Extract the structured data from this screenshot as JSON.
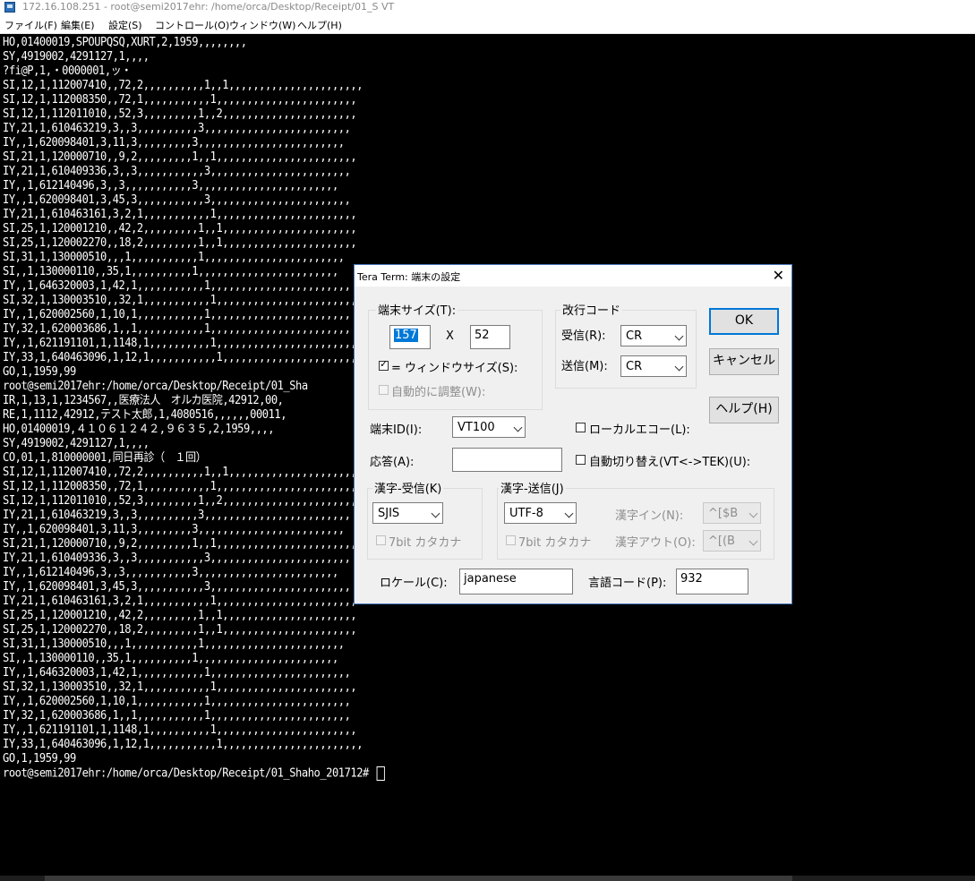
{
  "window": {
    "title": "172.16.108.251 - root@semi2017ehr: /home/orca/Desktop/Receipt/01_S VT"
  },
  "menubar": {
    "file": "ファイル(F)",
    "edit": "編集(E)",
    "setup": "設定(S)",
    "control": "コントロール(O)",
    "window": "ウィンドウ(W)",
    "help": "ヘルプ(H)"
  },
  "terminal": {
    "lines": [
      "HO,01400019,SPOUPQSQ,XURT,2,1959,,,,,,,,",
      "SY,4919002,4291127,1,,,,",
      "?fi@P,1,・0000001,ッ・",
      "SI,12,1,112007410,,72,2,,,,,,,,,,1,,1,,,,,,,,,,,,,,,,,,,,,,",
      "SI,12,1,112008350,,72,1,,,,,,,,,,,1,,,,,,,,,,,,,,,,,,,,,,,",
      "SI,12,1,112011010,,52,3,,,,,,,,,1,,2,,,,,,,,,,,,,,,,,,,,,,",
      "IY,21,1,610463219,3,,3,,,,,,,,,,3,,,,,,,,,,,,,,,,,,,,,,,,",
      "IY,,1,620098401,3,11,3,,,,,,,,,3,,,,,,,,,,,,,,,,,,,,,,,,",
      "SI,21,1,120000710,,9,2,,,,,,,,,1,,1,,,,,,,,,,,,,,,,,,,,,,,",
      "IY,21,1,610409336,3,,3,,,,,,,,,,,3,,,,,,,,,,,,,,,,,,,,,,,",
      "IY,,1,612140496,3,,3,,,,,,,,,,,3,,,,,,,,,,,,,,,,,,,,,,,",
      "IY,,1,620098401,3,45,3,,,,,,,,,,,3,,,,,,,,,,,,,,,,,,,,,,,",
      "IY,21,1,610463161,3,2,1,,,,,,,,,,,1,,,,,,,,,,,,,,,,,,,,,,,",
      "SI,25,1,120001210,,42,2,,,,,,,,,1,,1,,,,,,,,,,,,,,,,,,,,,,",
      "SI,25,1,120002270,,18,2,,,,,,,,,1,,1,,,,,,,,,,,,,,,,,,,,,,",
      "SI,31,1,130000510,,,1,,,,,,,,,,,1,,,,,,,,,,,,,,,,,,,,,,,",
      "SI,,1,130000110,,35,1,,,,,,,,,,1,,,,,,,,,,,,,,,,,,,,,,,",
      "IY,,1,646320003,1,42,1,,,,,,,,,,,1,,,,,,,,,,,,,,,,,,,,,,,",
      "SI,32,1,130003510,,32,1,,,,,,,,,,,1,,,,,,,,,,,,,,,,,,,,,,,",
      "IY,,1,620002560,1,10,1,,,,,,,,,,,1,,,,,,,,,,,,,,,,,,,,,,,",
      "IY,32,1,620003686,1,,1,,,,,,,,,,,1,,,,,,,,,,,,,,,,,,,,,,,",
      "IY,,1,621191101,1,1148,1,,,,,,,,,,1,,,,,,,,,,,,,,,,,,,,,,,",
      "IY,33,1,640463096,1,12,1,,,,,,,,,,,1,,,,,,,,,,,,,,,,,,,,,,,",
      "GO,1,1959,99",
      "root@semi2017ehr:/home/orca/Desktop/Receipt/01_Sha",
      "IR,1,13,1,1234567,,医療法人　オルカ医院,42912,00,",
      "RE,1,1112,42912,テスト太郎,1,4080516,,,,,,00011,",
      "HO,01400019,４１０６１２４２,９６３５,2,1959,,,,",
      "SY,4919002,4291127,1,,,,",
      "CO,01,1,810000001,同日再診（　１回）",
      "SI,12,1,112007410,,72,2,,,,,,,,,,1,,1,,,,,,,,,,,,,,,,,,,,,,",
      "SI,12,1,112008350,,72,1,,,,,,,,,,,1,,,,,,,,,,,,,,,,,,,,,,,",
      "SI,12,1,112011010,,52,3,,,,,,,,,1,,2,,,,,,,,,,,,,,,,,,,,,,",
      "IY,21,1,610463219,3,,3,,,,,,,,,,3,,,,,,,,,,,,,,,,,,,,,,,,",
      "IY,,1,620098401,3,11,3,,,,,,,,,3,,,,,,,,,,,,,,,,,,,,,,,,",
      "SI,21,1,120000710,,9,2,,,,,,,,,1,,1,,,,,,,,,,,,,,,,,,,,,,,",
      "IY,21,1,610409336,3,,3,,,,,,,,,,,3,,,,,,,,,,,,,,,,,,,,,,,",
      "IY,,1,612140496,3,,3,,,,,,,,,,,3,,,,,,,,,,,,,,,,,,,,,,,",
      "IY,,1,620098401,3,45,3,,,,,,,,,,,3,,,,,,,,,,,,,,,,,,,,,,,",
      "IY,21,1,610463161,3,2,1,,,,,,,,,,,1,,,,,,,,,,,,,,,,,,,,,,,",
      "SI,25,1,120001210,,42,2,,,,,,,,,1,,1,,,,,,,,,,,,,,,,,,,,,,",
      "SI,25,1,120002270,,18,2,,,,,,,,,1,,1,,,,,,,,,,,,,,,,,,,,,,",
      "SI,31,1,130000510,,,1,,,,,,,,,,,1,,,,,,,,,,,,,,,,,,,,,,,",
      "SI,,1,130000110,,35,1,,,,,,,,,,1,,,,,,,,,,,,,,,,,,,,,,,",
      "IY,,1,646320003,1,42,1,,,,,,,,,,,1,,,,,,,,,,,,,,,,,,,,,,,",
      "SI,32,1,130003510,,32,1,,,,,,,,,,,1,,,,,,,,,,,,,,,,,,,,,,,",
      "IY,,1,620002560,1,10,1,,,,,,,,,,,1,,,,,,,,,,,,,,,,,,,,,,,",
      "IY,32,1,620003686,1,,1,,,,,,,,,,,1,,,,,,,,,,,,,,,,,,,,,,,",
      "IY,,1,621191101,1,1148,1,,,,,,,,,,1,,,,,,,,,,,,,,,,,,,,,,,",
      "IY,33,1,640463096,1,12,1,,,,,,,,,,,1,,,,,,,,,,,,,,,,,,,,,,,",
      "GO,1,1959,99"
    ],
    "prompt": "root@semi2017ehr:/home/orca/Desktop/Receipt/01_Shaho_201712# "
  },
  "dialog": {
    "title": "Tera Term: 端末の設定",
    "terminal_size": {
      "group_label": "端末サイズ(T):",
      "width_value": "157",
      "x_label": "X",
      "height_value": "52",
      "window_size_label": "= ウィンドウサイズ(S):",
      "window_size_checked": true,
      "auto_adjust_label": "自動的に調整(W):"
    },
    "newline": {
      "group_label": "改行コード",
      "receive_label": "受信(R):",
      "receive_value": "CR",
      "send_label": "送信(M):",
      "send_value": "CR"
    },
    "buttons": {
      "ok": "OK",
      "cancel": "キャンセル",
      "help": "ヘルプ(H)"
    },
    "terminal_id_label": "端末ID(I):",
    "terminal_id_value": "VT100",
    "local_echo_label": "ローカルエコー(L):",
    "answerback_label": "応答(A):",
    "answerback_value": "",
    "auto_switch_label": "自動切り替え(VT<->TEK)(U):",
    "kanji_receive": {
      "group_label": "漢字-受信(K)",
      "value": "SJIS",
      "seven_bit_label": "7bit カタカナ"
    },
    "kanji_send": {
      "group_label": "漢字-送信(J)",
      "value": "UTF-8",
      "seven_bit_label": "7bit カタカナ",
      "kanji_in_label": "漢字イン(N):",
      "kanji_in_value": "^[$B",
      "kanji_out_label": "漢字アウト(O):",
      "kanji_out_value": "^[(B"
    },
    "locale_label": "ロケール(C):",
    "locale_value": "japanese",
    "codepage_label": "言語コード(P):",
    "codepage_value": "932"
  }
}
